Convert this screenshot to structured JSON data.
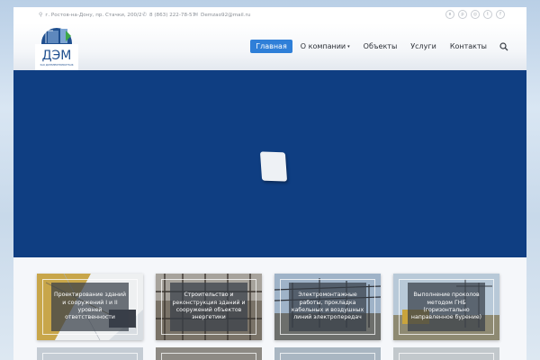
{
  "topbar": {
    "address": "г. Ростов-на-Дону, пр. Стачки, 200/2",
    "phone": "8 (863) 222-78-57",
    "email": "Demzao92@mail.ru",
    "social": [
      "vk-icon",
      "pinterest-icon",
      "instagram-icon",
      "twitter-icon",
      "facebook-icon"
    ],
    "social_glyphs": [
      "в",
      "p",
      "◎",
      "t",
      "f"
    ]
  },
  "logo": {
    "text": "ДЭМ",
    "subtitle": "ЗАО ДОНЭЛЕКТРОМОНТАЖ"
  },
  "nav": {
    "items": [
      {
        "label": "Главная",
        "active": true
      },
      {
        "label": "О компании",
        "active": false,
        "dropdown": true
      },
      {
        "label": "Объекты",
        "active": false
      },
      {
        "label": "Услуги",
        "active": false
      },
      {
        "label": "Контакты",
        "active": false
      }
    ]
  },
  "colors": {
    "accent": "#2f7fd8",
    "hero": "#0f3e82"
  },
  "cards": [
    {
      "label": "Проектирование зданий и сооружений I и II уровней ответственности"
    },
    {
      "label": "Строительство и реконструкция зданий и сооружений объектов энергетики"
    },
    {
      "label": "Электромонтажные работы, прокладка кабельных и воздушных линий электропередач"
    },
    {
      "label": "Выполнение проколов методом ГНБ (горизонтально направленное бурение)"
    }
  ]
}
